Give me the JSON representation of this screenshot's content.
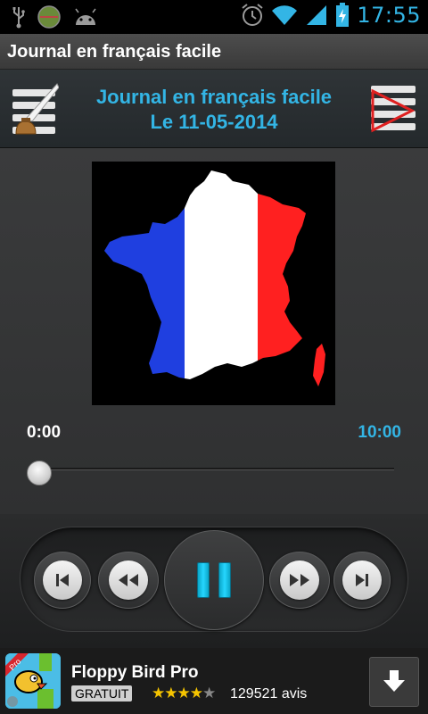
{
  "status_bar": {
    "time": "17:55",
    "icons": [
      "usb-icon",
      "circle-app-icon",
      "android-icon",
      "alarm-icon",
      "wifi-icon",
      "signal-icon",
      "battery-charging-icon"
    ]
  },
  "app_title": "Journal en français facile",
  "header": {
    "title": "Journal en français facile",
    "date": "Le 11-05-2014",
    "left_icon": "notes-pen-icon",
    "right_icon": "playlist-play-icon"
  },
  "player": {
    "artwork": "france-flag-map",
    "time_elapsed": "0:00",
    "time_total": "10:00",
    "progress": 0,
    "state": "playing"
  },
  "controls": {
    "buttons": [
      "skip-previous",
      "rewind",
      "pause",
      "fast-forward",
      "skip-next"
    ]
  },
  "ad": {
    "badge": "Pro",
    "title": "Floppy Bird Pro",
    "price_label": "GRATUIT",
    "rating": 4,
    "rating_max": 5,
    "reviews": "129521 avis"
  },
  "colors": {
    "accent": "#33b5e5",
    "flag_blue": "#1f3fe0",
    "flag_white": "#ffffff",
    "flag_red": "#ff2020"
  }
}
